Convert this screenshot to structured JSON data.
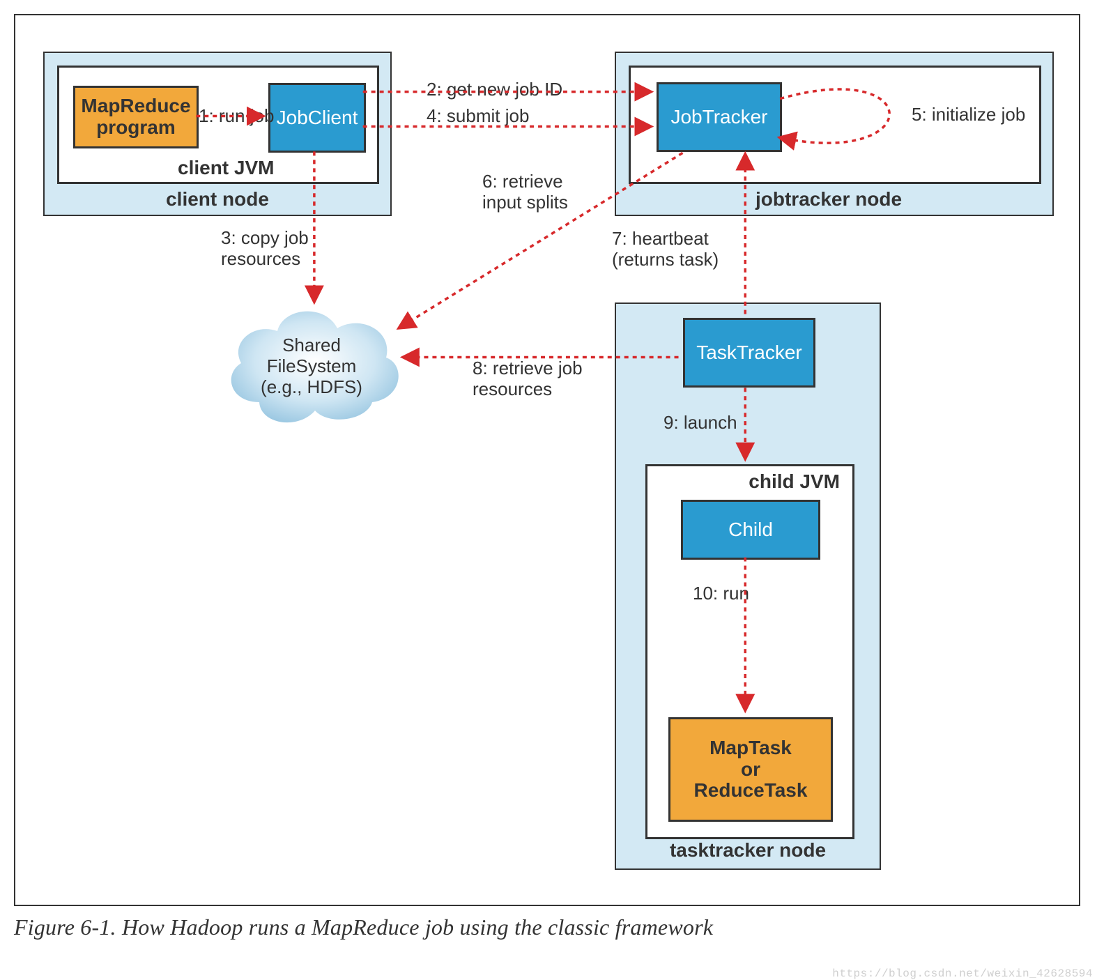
{
  "caption": "Figure 6-1. How Hadoop runs a MapReduce job using the classic framework",
  "watermark": "https://blog.csdn.net/weixin_42628594",
  "client_node": {
    "label": "client node",
    "jvm_label": "client JVM",
    "program": "MapReduce\nprogram",
    "jobclient": "JobClient"
  },
  "jobtracker_node": {
    "label": "jobtracker node",
    "jobtracker": "JobTracker"
  },
  "tasktracker_node": {
    "label": "tasktracker node",
    "tasktracker": "TaskTracker",
    "child_jvm_label": "child JVM",
    "child": "Child",
    "maptask": "MapTask\nor\nReduceTask"
  },
  "cloud": {
    "label": "Shared\nFileSystem\n(e.g., HDFS)"
  },
  "steps": {
    "s1": "1: run job",
    "s2": "2: get new job ID",
    "s3": "3: copy job\nresources",
    "s4": "4: submit job",
    "s5": "5: initialize job",
    "s6": "6: retrieve\ninput splits",
    "s7": "7: heartbeat\n(returns task)",
    "s8": "8: retrieve job\nresources",
    "s9": "9: launch",
    "s10": "10: run"
  }
}
